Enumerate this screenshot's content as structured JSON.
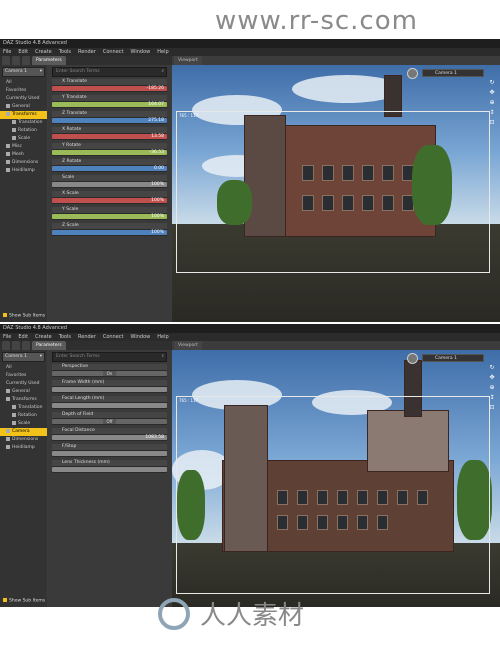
{
  "watermark_top": "www.rr-sc.com",
  "watermark_bottom": "人人素材",
  "app_title": "DAZ Studio 4.8 Advanced",
  "menu": [
    "File",
    "Edit",
    "Create",
    "Tools",
    "Render",
    "Connect",
    "Window",
    "Help"
  ],
  "tabs": [
    "",
    "",
    "",
    "Parameters"
  ],
  "viewport_tab": "Viewport",
  "camera_selector": "Camera 1",
  "categories": [
    "All",
    "Favorites",
    "Currently Used"
  ],
  "show_sub_items": "Show Sub Items",
  "filter_placeholder": "Enter Search Terms",
  "panel1": {
    "tree": [
      {
        "label": "General",
        "level": 0
      },
      {
        "label": "Transforms",
        "level": 0,
        "selected": true
      },
      {
        "label": "Translation",
        "level": 1
      },
      {
        "label": "Rotation",
        "level": 1
      },
      {
        "label": "Scale",
        "level": 1
      },
      {
        "label": "Misc",
        "level": 0
      },
      {
        "label": "Mesh",
        "level": 0
      },
      {
        "label": "Dimensions",
        "level": 0
      },
      {
        "label": "Heidilamp",
        "level": 0
      }
    ],
    "params": [
      {
        "label": "X Translate",
        "value": "-185.26",
        "color": "#c0504d"
      },
      {
        "label": "Y Translate",
        "value": "164.07",
        "color": "#9bbb59"
      },
      {
        "label": "Z Translate",
        "value": "275.18",
        "color": "#4f81bd"
      },
      {
        "label": "X Rotate",
        "value": "13.58",
        "color": "#c0504d"
      },
      {
        "label": "Y Rotate",
        "value": "-36.53",
        "color": "#9bbb59"
      },
      {
        "label": "Z Rotate",
        "value": "0.00",
        "color": "#4f81bd"
      },
      {
        "label": "Scale",
        "value": "100%",
        "color": "#888888"
      },
      {
        "label": "X Scale",
        "value": "100%",
        "color": "#c0504d"
      },
      {
        "label": "Y Scale",
        "value": "100%",
        "color": "#9bbb59"
      },
      {
        "label": "Z Scale",
        "value": "100%",
        "color": "#4f81bd"
      }
    ],
    "coord": "765 : 117"
  },
  "panel2": {
    "tree": [
      {
        "label": "General",
        "level": 0
      },
      {
        "label": "Transforms",
        "level": 0
      },
      {
        "label": "Translation",
        "level": 1
      },
      {
        "label": "Rotation",
        "level": 1
      },
      {
        "label": "Scale",
        "level": 1
      },
      {
        "label": "Camera",
        "level": 0,
        "selected": true
      },
      {
        "label": "Dimensions",
        "level": 0
      },
      {
        "label": "Heidilamp",
        "level": 0
      }
    ],
    "params": [
      {
        "label": "Perspective",
        "value": "",
        "button": "On",
        "color": "#666666"
      },
      {
        "label": "Frame Width (mm)",
        "value": "",
        "color": "#888888"
      },
      {
        "label": "Focal Length (mm)",
        "value": "",
        "color": "#888888"
      },
      {
        "label": "Depth of Field",
        "value": "",
        "button": "Off",
        "color": "#666666"
      },
      {
        "label": "Focal Distance",
        "value": "1083.58",
        "color": "#888888"
      },
      {
        "label": "F/Stop",
        "value": "",
        "color": "#888888"
      },
      {
        "label": "Lens Thickness (mm)",
        "value": "",
        "color": "#888888"
      }
    ],
    "coord": "765 : 117"
  }
}
